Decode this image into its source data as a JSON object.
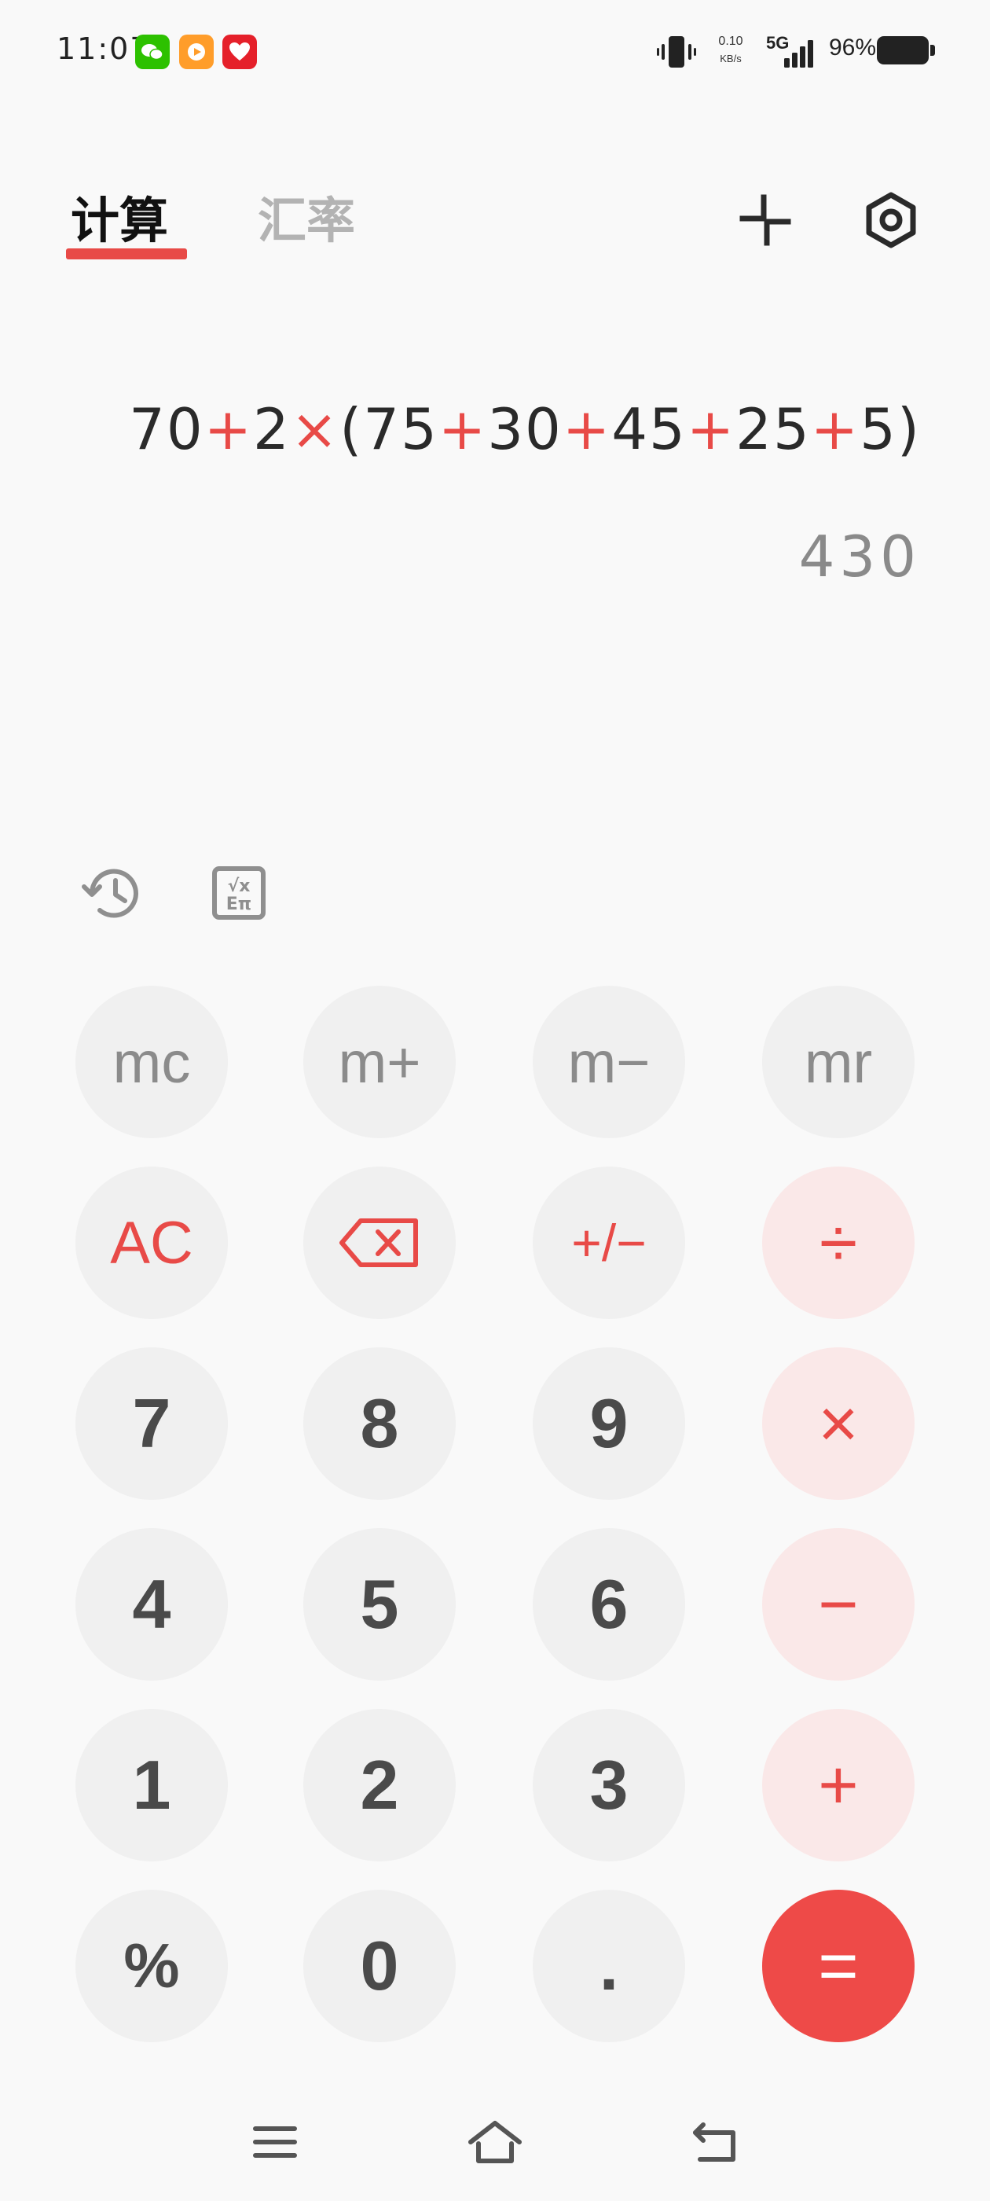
{
  "status_bar": {
    "time": "11:07",
    "net_speed_value": "0.10",
    "net_speed_unit": "KB/s",
    "network": "5G",
    "battery": "96%",
    "apps": [
      "wechat-icon",
      "video-app-icon",
      "heart-app-icon"
    ]
  },
  "tabs": [
    {
      "label": "计算",
      "active": true
    },
    {
      "label": "汇率",
      "active": false
    }
  ],
  "display": {
    "expression_parts": [
      {
        "t": "70"
      },
      {
        "t": "+",
        "op": true
      },
      {
        "t": "2"
      },
      {
        "t": "×",
        "op": true
      },
      {
        "t": "(75"
      },
      {
        "t": "+",
        "op": true
      },
      {
        "t": "30"
      },
      {
        "t": "+",
        "op": true
      },
      {
        "t": "45"
      },
      {
        "t": "+",
        "op": true
      },
      {
        "t": "25"
      },
      {
        "t": "+",
        "op": true
      },
      {
        "t": "5)"
      }
    ],
    "result": "430"
  },
  "keypad": {
    "mc": "mc",
    "m_plus": "m+",
    "m_minus": "m−",
    "mr": "mr",
    "ac": "AC",
    "sign": "+/−",
    "divide": "÷",
    "seven": "7",
    "eight": "8",
    "nine": "9",
    "multiply": "×",
    "four": "4",
    "five": "5",
    "six": "6",
    "minus": "−",
    "one": "1",
    "two": "2",
    "three": "3",
    "plus": "+",
    "percent": "%",
    "zero": "0",
    "dot": ".",
    "equals": "="
  },
  "colors": {
    "accent": "#e84a47",
    "key_bg": "#f0f0f0",
    "operator_bg": "#fae8e8",
    "equals_bg": "#ee4a48"
  }
}
